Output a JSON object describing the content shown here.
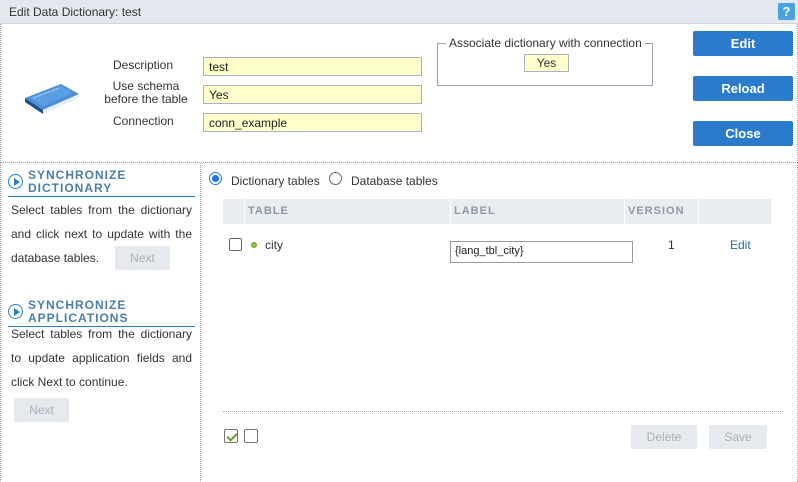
{
  "window": {
    "title": "Edit Data Dictionary: test",
    "help_label": "?"
  },
  "form": {
    "description_label": "Description",
    "description_value": "test",
    "schema_label_line1": "Use schema",
    "schema_label_line2": "before the table",
    "schema_value": "Yes",
    "connection_label": "Connection",
    "connection_value": "conn_example",
    "assoc_legend": "Associate dictionary with connection",
    "assoc_value": "Yes"
  },
  "actions": {
    "edit": "Edit",
    "reload": "Reload",
    "close": "Close"
  },
  "sync_dictionary": {
    "title_line1": "SYNCHRONIZE",
    "title_line2": "DICTIONARY",
    "text": "Select tables from the dictionary and click next to update with the database tables.",
    "next_label": "Next"
  },
  "sync_applications": {
    "title_line1": "SYNCHRONIZE",
    "title_line2": "APPLICATIONS",
    "text": "Select tables from the dictionary to update application fields and click Next to continue.",
    "next_label": "Next"
  },
  "source": {
    "options": [
      "Dictionary tables",
      "Database tables"
    ],
    "selected": "Dictionary tables"
  },
  "grid": {
    "columns": [
      "TABLE",
      "LABEL",
      "VERSION"
    ],
    "rows": [
      {
        "table": "city",
        "label": "{lang_tbl_city}",
        "version": "1",
        "action": "Edit",
        "checked": false
      }
    ],
    "delete_label": "Delete",
    "save_label": "Save"
  },
  "colors": {
    "primary": "#2a7bcb",
    "field_bg": "#ffffcc",
    "status_dot": "#8cc63f"
  }
}
